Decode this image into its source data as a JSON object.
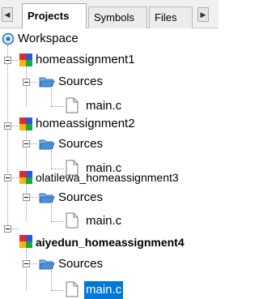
{
  "tabs": [
    {
      "label": "Projects",
      "active": true
    },
    {
      "label": "Symbols",
      "active": false
    },
    {
      "label": "Files",
      "active": false
    }
  ],
  "tree": {
    "root": "Workspace",
    "projects": [
      {
        "name": "homeassignment1",
        "folder": "Sources",
        "file": "main.c",
        "active": false
      },
      {
        "name": "homeassignment2",
        "folder": "Sources",
        "file": "main.c",
        "active": false
      },
      {
        "name": "olatilewa_homeassignment3",
        "folder": "Sources",
        "file": "main.c",
        "active": false
      },
      {
        "name": "aiyedun_homeassignment4",
        "folder": "Sources",
        "file": "main.c",
        "active": true,
        "file_selected": true
      }
    ]
  },
  "colors": {
    "selection": "#0078d7",
    "folder": "#4a90d9"
  }
}
